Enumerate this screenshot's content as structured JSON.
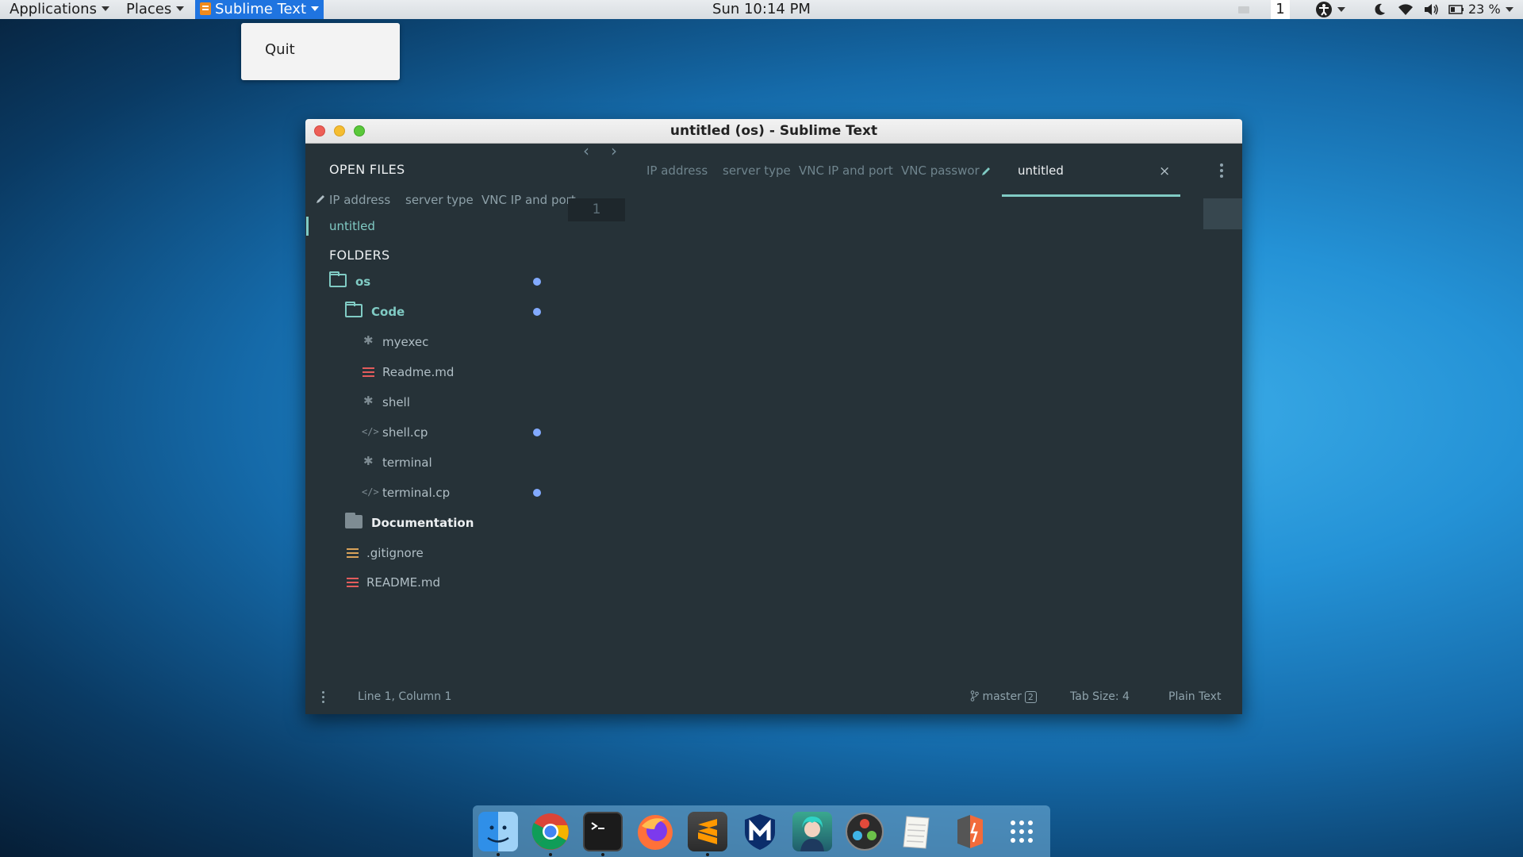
{
  "topbar": {
    "applications": "Applications",
    "places": "Places",
    "active_app": "Sublime Text",
    "clock": "Sun 10:14 PM",
    "workspace": "1",
    "battery": "23 %"
  },
  "app_menu": {
    "quit": "Quit"
  },
  "window": {
    "title": "untitled (os) - Sublime Text",
    "sidebar": {
      "open_files_heading": "OPEN FILES",
      "open_file_tabs": [
        "IP address",
        "server type",
        "VNC IP and port"
      ],
      "open_file_selected": "untitled",
      "folders_heading": "FOLDERS",
      "tree": {
        "root": "os",
        "code": "Code",
        "myexec": "myexec",
        "readme_lower": "Readme.md",
        "shell": "shell",
        "shell_cp": "shell.cp",
        "terminal": "terminal",
        "terminal_cp": "terminal.cp",
        "documentation": "Documentation",
        "gitignore": ".gitignore",
        "readme_upper": "README.md"
      }
    },
    "tabs": [
      "IP address",
      "server type",
      "VNC IP and port",
      "VNC passwor",
      "untitled"
    ],
    "active_tab": "untitled",
    "close_glyph": "×",
    "gutter_line": "1",
    "status": {
      "position": "Line 1, Column 1",
      "branch": "master",
      "branch_badge": "2",
      "tab_size": "Tab Size: 4",
      "syntax": "Plain Text"
    }
  },
  "dock": {
    "items": [
      "finder-icon",
      "chrome-icon",
      "terminal-icon",
      "firefox-icon",
      "sublime-text-icon",
      "malwarebytes-icon",
      "anime-app-icon",
      "davinci-resolve-icon",
      "text-editor-icon",
      "file-manager-icon",
      "app-grid-icon"
    ]
  },
  "colors": {
    "accent": "#80cbc4",
    "modified_dot": "#82aaff",
    "editor_bg": "#263238",
    "topbar_active": "#1f74e0"
  }
}
